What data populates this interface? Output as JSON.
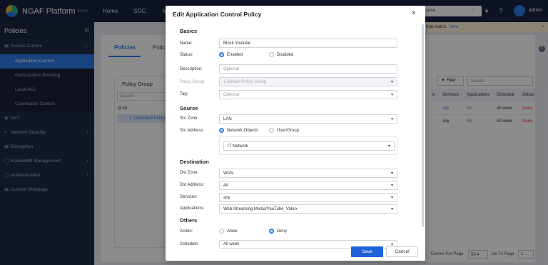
{
  "app": {
    "name": "NGAF Platform",
    "version": "8.0.58"
  },
  "nav": [
    "Home",
    "SOC",
    "M"
  ],
  "topbar": {
    "search_text": "name",
    "user": "admin"
  },
  "sidebar": {
    "title": "Policies",
    "items": [
      {
        "label": "Access Control",
        "icon": "shield-icon"
      },
      {
        "label": "Application Control"
      },
      {
        "label": "GeoLocation Blocking"
      },
      {
        "label": "Local ACL"
      },
      {
        "label": "Connection Control"
      },
      {
        "label": "NAT",
        "icon": "nat-icon"
      },
      {
        "label": "Network Security",
        "icon": "network-icon"
      },
      {
        "label": "Decryption",
        "icon": "lock-icon"
      },
      {
        "label": "Bandwidth Management",
        "icon": "bandwidth-icon"
      },
      {
        "label": "Authentication",
        "icon": "user-icon"
      },
      {
        "label": "Custom Webpage",
        "icon": "page-icon"
      }
    ]
  },
  "background": {
    "notice": "that match.",
    "notice_link": "View",
    "tabs": [
      "Policies",
      "Polic"
    ],
    "policy_group_title": "Policy Group",
    "search_placeholder": "Search",
    "tree_all": "All",
    "tree_default": "1. (2)Default Policy Group",
    "filter": "Filter",
    "right_search": "Search",
    "columns": [
      "e",
      "Services",
      "Applications",
      "Schedule",
      "Action"
    ],
    "rows": [
      [
        "any",
        "All",
        "All week",
        "Deny"
      ],
      [
        "any",
        "All",
        "All week",
        "Deny"
      ]
    ],
    "pager_label": "Entries Per Page",
    "pager_value": "50",
    "goto_label": "Go To Page",
    "goto_value": "1"
  },
  "modal": {
    "title": "Edit Application Control Policy",
    "sections": {
      "basics": "Basics",
      "source": "Source",
      "destination": "Destination",
      "others": "Others"
    },
    "name_label": "Name:",
    "name_value": "Block Youtube",
    "status_label": "Status:",
    "status_enabled": "Enabled",
    "status_disabled": "Disabled",
    "description_label": "Description:",
    "description_placeholder": "Optional",
    "policy_group_label": "Policy Group",
    "policy_group_value": "1.Default Policy Group",
    "tag_label": "Tag:",
    "tag_placeholder": "Optional",
    "src_zone_label": "Src Zone:",
    "src_zone_value": "LAN",
    "src_address_label": "Src Address:",
    "src_opt_network": "Network Objects",
    "src_opt_user": "User/Group",
    "src_object_value": "IT Network",
    "dst_zone_label": "Dst Zone:",
    "dst_zone_value": "WAN",
    "dst_address_label": "Dst Address:",
    "dst_address_value": "All",
    "services_label": "Services:",
    "services_value": "any",
    "applications_label": "Applications:",
    "applications_value": "Web Streaming Media/YouTube_Video",
    "action_label": "Action:",
    "action_allow": "Allow",
    "action_deny": "Deny",
    "schedule_label": "Schedule:",
    "schedule_value": "All week",
    "save": "Save",
    "cancel": "Cancel"
  },
  "colors": {
    "accent": "#2c7be5",
    "deny": "#d43a3a",
    "topbar": "#1b2440"
  }
}
